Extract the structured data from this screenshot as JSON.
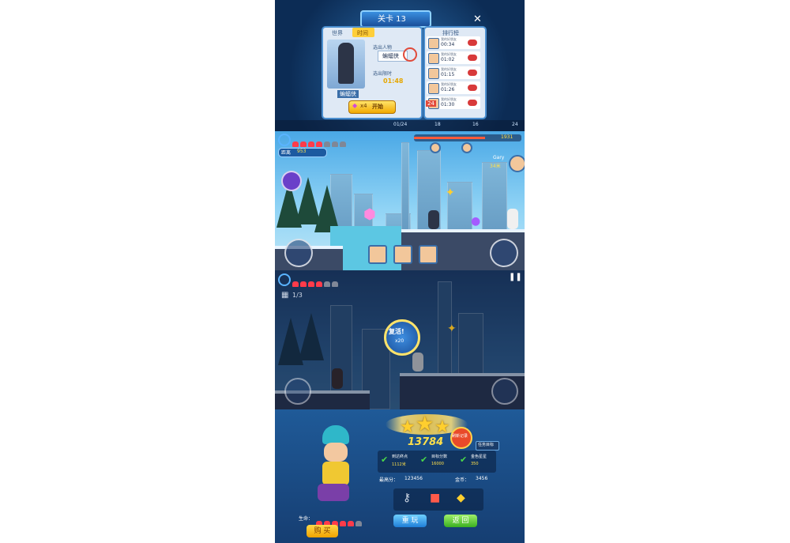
{
  "panel1": {
    "title": "关卡 13",
    "close_icon": "close-icon",
    "tabs": [
      "世界",
      "时间"
    ],
    "challenge_label": "选出人物",
    "hero_name_badge": "蝙蝠侠",
    "time_label": "选出限时",
    "time_value": "01:48",
    "char_caption": "蝙蝠侠",
    "cost": "x4",
    "start_button": "开始",
    "leaderboard": {
      "title": "排行榜",
      "rows": [
        {
          "name": "我的好朋友",
          "time": "00:34"
        },
        {
          "name": "我的好朋友",
          "time": "01:02"
        },
        {
          "name": "我的好朋友",
          "time": "01:15"
        },
        {
          "name": "我的好朋友",
          "time": "01:26"
        },
        {
          "name": "我的好朋友",
          "time": "01:30"
        }
      ],
      "rank_badge": "24",
      "rank4": "4"
    },
    "bottom_stats": [
      "01/24",
      "18",
      "16",
      "24"
    ]
  },
  "panel2": {
    "gauge_label": "距离",
    "gauge_value": "953",
    "top_score": "1931",
    "rival_name": "Gary",
    "rival_dist": "34米",
    "hearts_full": 4,
    "hearts_empty": 3
  },
  "panel3": {
    "counter": "1/3",
    "revive_label": "复活!",
    "revive_cost": "x20",
    "hearts_full": 4,
    "hearts_empty": 2
  },
  "panel4": {
    "score": "13784",
    "new_record": "刷新记录",
    "tasks_link": "任务目标",
    "stats": [
      {
        "label": "到达终点",
        "value": "1112米"
      },
      {
        "label": "目标分数",
        "value": "16000"
      },
      {
        "label": "金色星星",
        "value": "350"
      }
    ],
    "best_label": "最高分：",
    "best_value": "123456",
    "coin_label": "金币：",
    "coin_value": "3456",
    "life_label": "生命：",
    "buy_button": "购 买",
    "retry_button": "重 玩",
    "return_button": "返 回",
    "hearts_full": 5,
    "hearts_empty": 1
  }
}
